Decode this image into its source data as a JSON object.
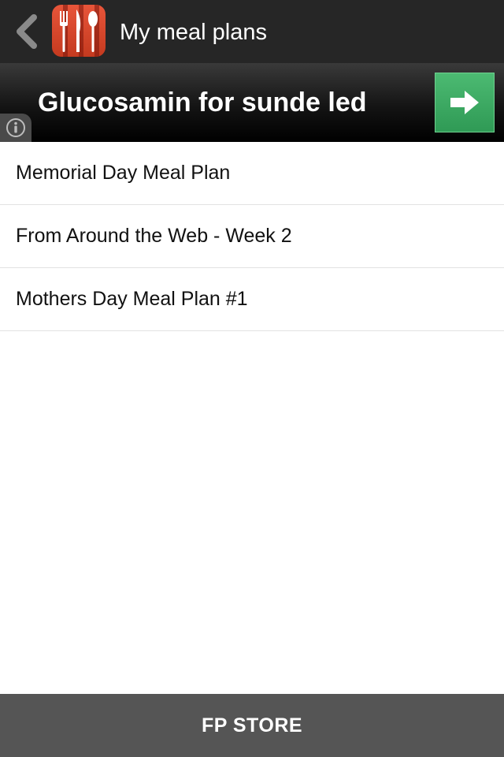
{
  "header": {
    "title": "My meal plans",
    "back_icon": "chevron-left-icon",
    "app_icon": "utensils-app-icon"
  },
  "banner": {
    "title": "Glucosamin for sunde led",
    "action_icon": "arrow-right-icon",
    "info_icon": "info-icon"
  },
  "meal_plans": [
    {
      "label": "Memorial Day Meal Plan"
    },
    {
      "label": "From Around the Web - Week 2"
    },
    {
      "label": "Mothers Day Meal Plan #1"
    }
  ],
  "footer": {
    "label": "FP STORE"
  },
  "colors": {
    "topbar": "#262626",
    "accent_green": "#3fae66",
    "app_icon_red": "#d8472b",
    "footer": "#555555"
  }
}
